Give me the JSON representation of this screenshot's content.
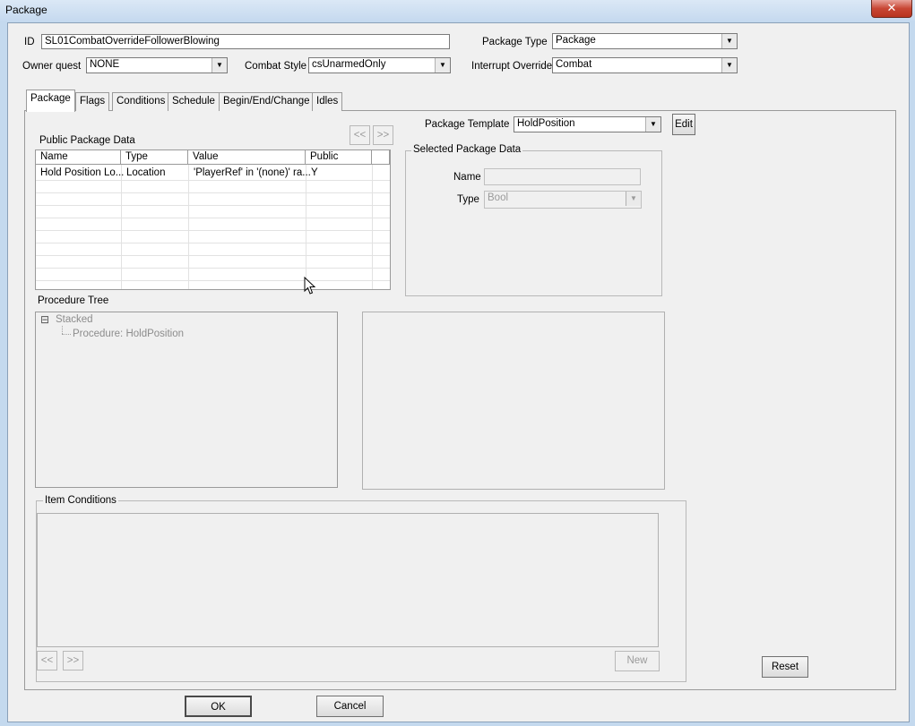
{
  "window": {
    "title": "Package",
    "close_glyph": "✕"
  },
  "header": {
    "id_label": "ID",
    "id_value": "SL01CombatOverrideFollowerBlowing",
    "package_type_label": "Package Type",
    "package_type_value": "Package",
    "owner_quest_label": "Owner quest",
    "owner_quest_value": "NONE",
    "combat_style_label": "Combat Style",
    "combat_style_value": "csUnarmedOnly",
    "interrupt_override_label": "Interrupt Override",
    "interrupt_override_value": "Combat"
  },
  "tabs": [
    {
      "label": "Package"
    },
    {
      "label": "Flags"
    },
    {
      "label": "Conditions"
    },
    {
      "label": "Schedule"
    },
    {
      "label": "Begin/End/Change"
    },
    {
      "label": "Idles"
    }
  ],
  "package_tab": {
    "public_data_label": "Public Package Data",
    "prev_label": "<<",
    "next_label": ">>",
    "columns": [
      "Name",
      "Type",
      "Value",
      "Public"
    ],
    "rows": [
      {
        "name": "Hold Position Lo...",
        "type": "Location",
        "value": "'PlayerRef' in '(none)' ra...",
        "public": "Y"
      }
    ],
    "template_label": "Package Template",
    "template_value": "HoldPosition",
    "edit_label": "Edit",
    "selected_data_title": "Selected Package Data",
    "name_label": "Name",
    "name_value": "",
    "type_label": "Type",
    "type_value": "Bool",
    "procedure_tree_label": "Procedure Tree",
    "tree": {
      "root": "Stacked",
      "child": "Procedure: HoldPosition",
      "expander": "⊟"
    },
    "item_conditions_title": "Item Conditions",
    "new_label": "New",
    "reset_label": "Reset"
  },
  "footer": {
    "ok_label": "OK",
    "cancel_label": "Cancel"
  },
  "colors": {
    "title_bar": "#c5d9ef",
    "close_button": "#c84634",
    "dialog_bg": "#f0f0f0"
  }
}
